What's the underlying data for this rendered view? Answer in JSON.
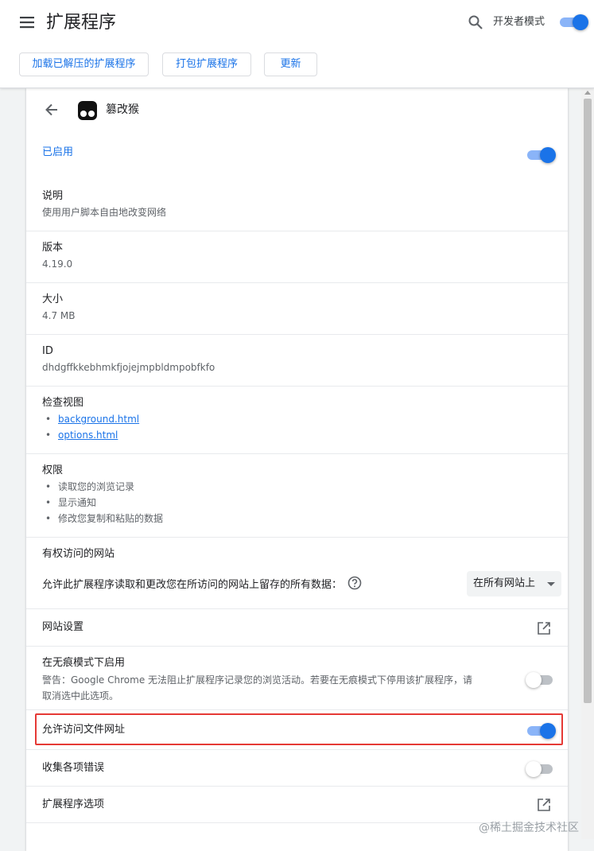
{
  "header": {
    "title": "扩展程序",
    "developer_mode_label": "开发者模式",
    "developer_mode_on": true,
    "buttons": {
      "load_unpacked": "加载已解压的扩展程序",
      "pack": "打包扩展程序",
      "update": "更新"
    }
  },
  "extension": {
    "name": "篡改猴",
    "enabled_label": "已启用",
    "enabled": true,
    "description": {
      "label": "说明",
      "value": "使用用户脚本自由地改变网络"
    },
    "version": {
      "label": "版本",
      "value": "4.19.0"
    },
    "size": {
      "label": "大小",
      "value": "4.7 MB"
    },
    "id": {
      "label": "ID",
      "value": "dhdgffkkebhmkfjojejmpbldmpobfkfo"
    },
    "inspect_views": {
      "label": "检查视图",
      "links": [
        "background.html",
        "options.html"
      ]
    },
    "permissions": {
      "label": "权限",
      "items": [
        "读取您的浏览记录",
        "显示通知",
        "修改您复制和粘贴的数据"
      ]
    },
    "site_access": {
      "label": "有权访问的网站",
      "text": "允许此扩展程序读取和更改您在所访问的网站上留存的所有数据：",
      "selected": "在所有网站上"
    },
    "site_settings_label": "网站设置",
    "incognito": {
      "label": "在无痕模式下启用",
      "warning_line1": "警告：Google Chrome 无法阻止扩展程序记录您的浏览活动。若要在无痕模式下停用该扩展程序，请",
      "warning_line2": "取消选中此选项。",
      "enabled": false
    },
    "file_urls": {
      "label": "允许访问文件网址",
      "enabled": true
    },
    "collect_errors": {
      "label": "收集各项错误",
      "enabled": false
    },
    "extension_options_label": "扩展程序选项"
  },
  "watermark": "@稀土掘金技术社区",
  "colors": {
    "accent": "#1a73e8",
    "highlight_border": "#e53935"
  },
  "icons": [
    "menu-icon",
    "search-icon",
    "back-icon",
    "extension-icon",
    "help-icon",
    "open-in-new-icon",
    "dropdown-caret-icon"
  ]
}
